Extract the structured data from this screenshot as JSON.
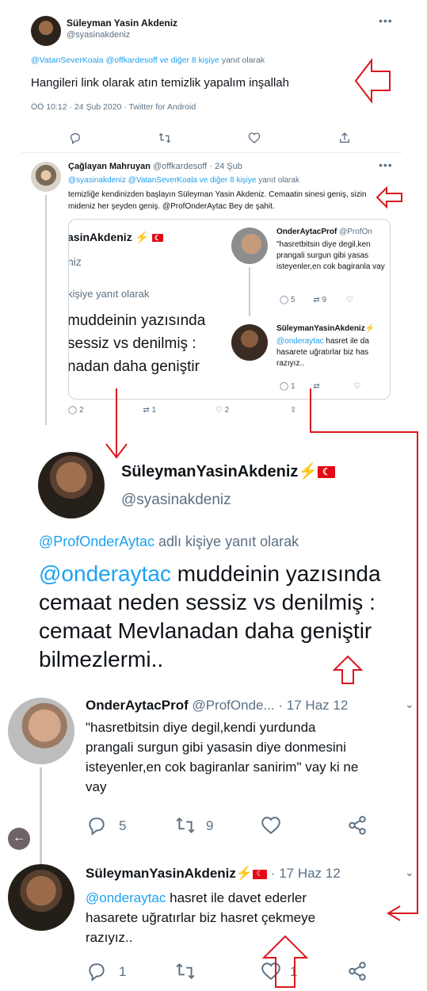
{
  "tweet1": {
    "name": "Süleyman Yasin Akdeniz",
    "handle": "@syasinakdeniz",
    "reply_mention_a": "@VatanSeverKoala",
    "reply_mention_b": "@offkardesoff",
    "reply_others": "ve diğer 8 kişiye",
    "reply_suffix": "yanıt olarak",
    "text": "Hangileri link olarak atın temizlik yapalım inşallah",
    "meta": "ÖÖ 10:12 · 24 Şub 2020 · Twitter for Android"
  },
  "tweet2": {
    "name": "Çağlayan Mahruyan",
    "handle": "@offkardesoff · 24 Şub",
    "reply_mentions": "@syasinakdeniz @VatanSeverKoala",
    "reply_others": "ve diğer 8 kişiye",
    "reply_suffix": "yanıt olarak",
    "text": "temizliğe kendinizden başlayın Süleyman Yasin Akdeniz. Cemaatin sinesi geniş, sizin mideniz her şeyden geniş. @ProfOnderAytac Bey de şahit.",
    "reply_count": "2",
    "retweet_count": "1",
    "like_count": "2"
  },
  "embed_small": {
    "left_name": "asinAkdeniz",
    "left_handle": "niz",
    "left_reply": "kişiye yanıt olarak",
    "left_text_1": "muddeinin yazısında",
    "left_text_2": "sessiz vs denilmiş :",
    "left_text_3": "nadan daha geniştir",
    "r1_name": "OnderAytacProf",
    "r1_handle": "@ProfOn",
    "r1_text": "\"hasretbitsin diye degil,ken prangali surgun gibi yasas isteyenler,en cok bagiranla vay",
    "r1_replies": "5",
    "r1_rts": "9",
    "r2_name": "SüleymanYasinAkdeniz",
    "r2_mention": "@onderaytac",
    "r2_text": "hasret ile da hasarete uğratırlar biz has razıyız..",
    "r2_replies": "1"
  },
  "zoom_main": {
    "name": "SüleymanYasinAkdeniz",
    "handle": "@syasinakdeniz",
    "reply_mention": "@ProfOnderAytac",
    "reply_suffix": "adlı kişiye yanıt olarak",
    "mention": "@onderaytac",
    "text_1": "muddeinin yazısında",
    "text_2": "cemaat neden sessiz vs denilmiş :",
    "text_3": "cemaat Mevlanadan daha geniştir",
    "text_4": "bilmezlermi.."
  },
  "zoom_reply1": {
    "name": "OnderAytacProf",
    "handle": "@ProfOnde...",
    "date": "· 17 Haz 12",
    "text_1": "\"hasretbitsin diye degil,kendi yurdunda",
    "text_2": "prangali surgun gibi yasasin diye donmesini",
    "text_3": "isteyenler,en cok bagiranlar sanirim\" vay ki ne",
    "text_4": "vay",
    "replies": "5",
    "retweets": "9"
  },
  "zoom_reply2": {
    "name": "SüleymanYasinAkdeniz",
    "date": "· 17 Haz 12",
    "mention": "@onderaytac",
    "text_1": "hasret ile davet ederler",
    "text_2": "hasarete uğratırlar biz hasret çekmeye",
    "text_3": "razıyız..",
    "replies": "1",
    "likes": "1"
  },
  "colors": {
    "link": "#1da1f2",
    "muted": "#5b7083",
    "annotation": "#d9181e"
  }
}
